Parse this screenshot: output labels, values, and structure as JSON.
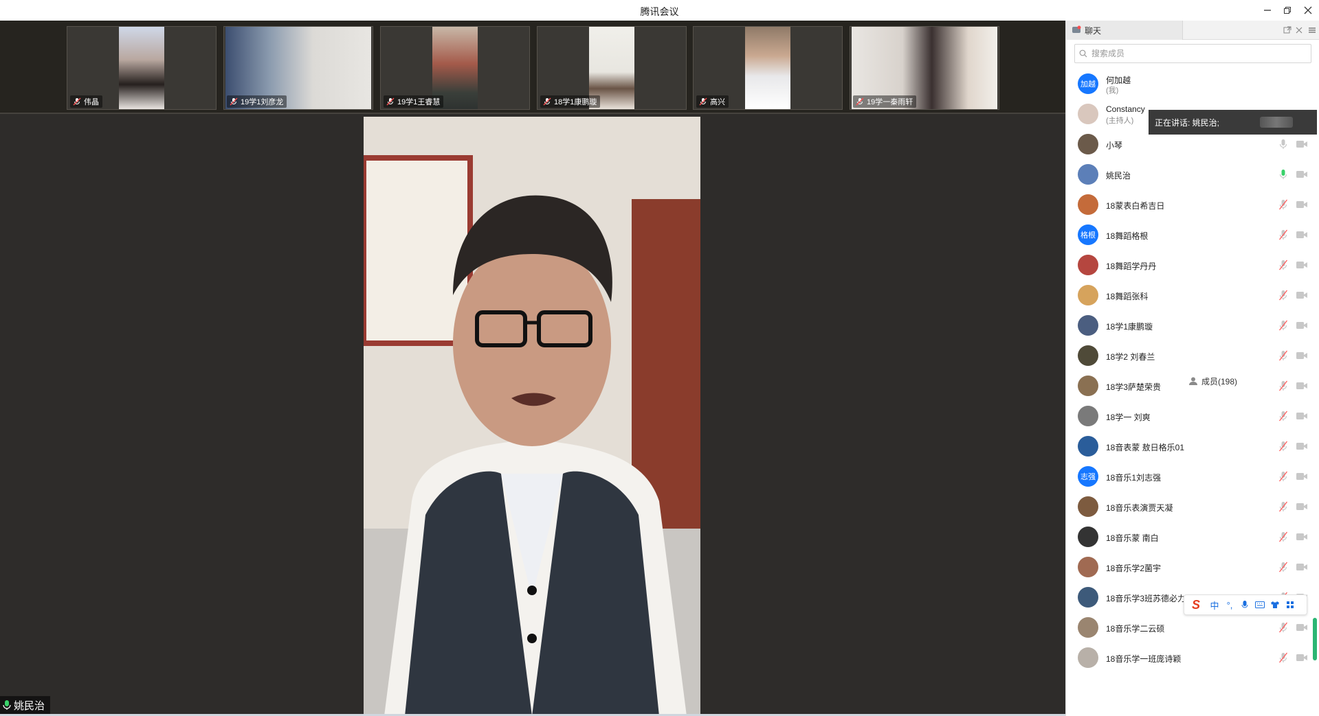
{
  "window": {
    "title": "腾讯会议"
  },
  "thumbnails": [
    {
      "name": "伟晶"
    },
    {
      "name": "19学1刘彦龙"
    },
    {
      "name": "19学1王睿慧"
    },
    {
      "name": "18学1康鹏璇"
    },
    {
      "name": "高兴"
    },
    {
      "name": "19学一秦雨轩"
    }
  ],
  "main_video": {
    "speaker_label": "姚民治"
  },
  "panel": {
    "chat_tab": "聊天",
    "members_tab": "成员(198)",
    "search_placeholder": "搜索成员",
    "speaking_tooltip": "正在讲话: 姚民治;",
    "members": [
      {
        "name": "何加越",
        "sub": "(我)",
        "avatar_text": "加越",
        "avatar_color": "#1677ff",
        "mic": "none",
        "cam": "none"
      },
      {
        "name": "Constancy",
        "sub": "(主持人)",
        "avatar_color": "#d9c7bd",
        "mic": "none",
        "cam": "none"
      },
      {
        "name": "小琴",
        "avatar_color": "#6b5a4a",
        "mic": "on",
        "cam": "off"
      },
      {
        "name": "姚民治",
        "avatar_color": "#5c7fb8",
        "mic": "speaking",
        "cam": "off"
      },
      {
        "name": "18蒙表白希吉日",
        "avatar_color": "#c46b3a",
        "mic": "muted",
        "cam": "off"
      },
      {
        "name": "18舞蹈格根",
        "avatar_text": "格根",
        "avatar_color": "#1677ff",
        "mic": "muted",
        "cam": "off"
      },
      {
        "name": "18舞蹈学丹丹",
        "avatar_color": "#b5463f",
        "mic": "muted",
        "cam": "off"
      },
      {
        "name": "18舞蹈张科",
        "avatar_color": "#d6a35c",
        "mic": "muted",
        "cam": "off"
      },
      {
        "name": "18学1康鹏璇",
        "avatar_color": "#4b5e80",
        "mic": "muted",
        "cam": "off"
      },
      {
        "name": "18学2 刘春兰",
        "avatar_color": "#4f4a38",
        "mic": "muted",
        "cam": "off"
      },
      {
        "name": "18学3萨楚荣贵",
        "avatar_color": "#8a7052",
        "mic": "muted",
        "cam": "off"
      },
      {
        "name": "18学一 刘爽",
        "avatar_color": "#7a7a7a",
        "mic": "muted",
        "cam": "off"
      },
      {
        "name": "18音表蒙 敖日格乐01",
        "avatar_color": "#2a5d9a",
        "mic": "muted",
        "cam": "off"
      },
      {
        "name": "18音乐1刘志强",
        "avatar_text": "志强",
        "avatar_color": "#1677ff",
        "mic": "muted",
        "cam": "off"
      },
      {
        "name": "18音乐表演贾天凝",
        "avatar_color": "#7d5b3f",
        "mic": "muted",
        "cam": "off"
      },
      {
        "name": "18音乐蒙 南白",
        "avatar_color": "#333333",
        "mic": "muted",
        "cam": "off"
      },
      {
        "name": "18音乐学2菌宇",
        "avatar_color": "#a06a52",
        "mic": "muted",
        "cam": "off"
      },
      {
        "name": "18音乐学3班苏德必力",
        "avatar_color": "#3d5a7a",
        "mic": "muted",
        "cam": "off"
      },
      {
        "name": "18音乐学二云硕",
        "avatar_color": "#9a8570",
        "mic": "muted",
        "cam": "off"
      },
      {
        "name": "18音乐学一班庞诗颖",
        "avatar_color": "#b8b0a8",
        "mic": "muted",
        "cam": "off"
      }
    ]
  },
  "ime_toolbar": {
    "mode": "中",
    "punct": "°,"
  }
}
